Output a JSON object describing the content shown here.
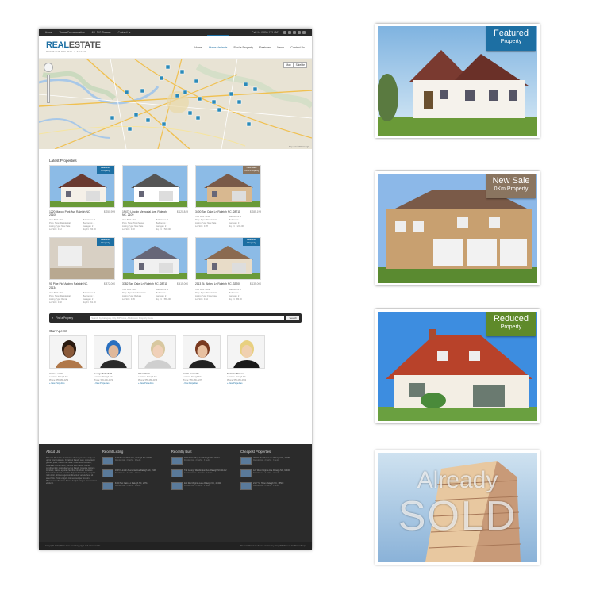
{
  "topbar": {
    "links": [
      "Home",
      "Theme Documentation",
      "ALL DIG Themes",
      "Contact Us"
    ],
    "phone": "Call Us: 0-800-123-4567"
  },
  "logo": {
    "part1": "REAL",
    "part2": "ESTATE",
    "tagline": "PREMIUM DRUPAL 7 THEME"
  },
  "nav": [
    "Home",
    "Home Variants",
    "Find a Property",
    "Features",
    "News",
    "Contact Us"
  ],
  "map": {
    "type_map": "Map",
    "type_sat": "Satellite",
    "attribution": "Map data ©2012 Google"
  },
  "latest": {
    "title": "Latest Properties",
    "cards": [
      {
        "addr": "1220 Macon Park Ave Raleigh NC, 21100",
        "price": "$ 250,999",
        "ribbon": "Featured",
        "ribbon_sub": "Property",
        "ribbon_color": "#1d6fa3",
        "specs": [
          "Year Built: 2012",
          "Bathrooms: 3",
          "Prop. Type: Residential",
          "Bedrooms: 4",
          "Listing Type: New Sale",
          "Garages: 2",
          "Lot Size: 0.12",
          "Sq. Ft: 450.00"
        ]
      },
      {
        "addr": "19472 Lincoln Memorial Ave, Raleigh NC, 2109",
        "price": "$ 120,849",
        "ribbon": "",
        "ribbon_sub": "",
        "ribbon_color": "",
        "specs": [
          "Year Built: 2011",
          "Bathrooms: 2",
          "Prop. Type: Townhouse",
          "Bedrooms: 3",
          "Listing Type: New Sale",
          "Garages: 2",
          "Lot Size: 0.22",
          "Sq. Ft: 2 560.00"
        ]
      },
      {
        "addr": "3400 Tan Oaks Ln Raleigh NC, 28711",
        "price": "$ 285,199",
        "ribbon": "New Sale",
        "ribbon_sub": "OKm Property",
        "ribbon_color": "#8a7560",
        "specs": [
          "Year Built: 2010",
          "Bathrooms: 3",
          "Prop. Type: Residential",
          "Bedrooms: 4",
          "Listing Type: New Sale",
          "Garages: 3",
          "Lot Size: 0.78",
          "Sq. Ft: 3 225.00"
        ]
      },
      {
        "addr": "91 Pine Ptof Audrey Raleigh NC, 21134",
        "price": "$ 872,000",
        "ribbon": "Featured",
        "ribbon_sub": "Property",
        "ribbon_color": "#1d6fa3",
        "specs": [
          "Year Built: 2012",
          "Bathrooms: 4",
          "Prop. Type: Residential",
          "Bedrooms: 5",
          "Listing Type: Rental",
          "Garages: 2",
          "Lot Size: 0.32",
          "Sq. Ft: 651.00"
        ]
      },
      {
        "addr": "3382 Tan Oaks Ln Raleigh NC, 28711",
        "price": "$ 415,000",
        "ribbon": "",
        "ribbon_sub": "",
        "ribbon_color": "",
        "specs": [
          "Year Built: 2009",
          "Bathrooms: 3",
          "Prop. Type: Condominium",
          "Bedrooms: 4",
          "Listing Type: Reduce",
          "Garages: 2",
          "Lot Size: 0.45",
          "Sq. Ft: 2 856.00"
        ]
      },
      {
        "addr": "2113 St. Abbey Ln Raleigh NC, 33200",
        "price": "$ 135,000",
        "ribbon": "Featured",
        "ribbon_sub": "Property",
        "ribbon_color": "#1d6fa3",
        "specs": [
          "Year Built: 2009",
          "Bathrooms: 2",
          "Prop. Type: Residential",
          "Bedrooms: 4",
          "Listing Type: Foreclosed",
          "Garages: 2",
          "Lot Size: 0.54",
          "Sq. Ft: 380.00"
        ]
      }
    ]
  },
  "search": {
    "label": "Find a Property",
    "placeholder": "Search by Category, City, ZIP Code, Address or Property Code",
    "button": "Search"
  },
  "agents": {
    "title": "Our Agents",
    "list": [
      {
        "name": "Annie Lowris",
        "location": "Location: Raleigh NC",
        "phone": "Phone: 555-286-4252",
        "link": "» View Properties",
        "shirt": "#b0784a",
        "skin": "#8a5a3a",
        "hair": "#2a1a10"
      },
      {
        "name": "George Schofield",
        "location": "Location: Raleigh NC",
        "phone": "Phone: 555-286-4372",
        "link": "» View Properties",
        "shirt": "#2a2a2a",
        "skin": "#e0b89a",
        "hair": "#2a70c0"
      },
      {
        "name": "Olivia Paris",
        "location": "Location: Raleigh NC",
        "phone": "Phone: 555-286-4153",
        "link": "» View Properties",
        "shirt": "#cfcfcf",
        "skin": "#f0d0b8",
        "hair": "#d8c8a0"
      },
      {
        "name": "Sarah Connolly",
        "location": "Location: Raleigh NC",
        "phone": "Phone: 555-286-4237",
        "link": "» View Properties",
        "shirt": "#222",
        "skin": "#e8c0a0",
        "hair": "#7a3a20"
      },
      {
        "name": "Stefanie Mason",
        "location": "Location: Raleigh NC",
        "phone": "Phone: 555-286-4352",
        "link": "» View Properties",
        "shirt": "#1a1a1a",
        "skin": "#f0d0b0",
        "hair": "#e8d080"
      }
    ]
  },
  "footer": {
    "about_title": "About Us",
    "about_text": "This is a Premium Real Estate theme you can easily set up for your business. Curabitur blandit sem, consectetur gravida justo, blandit nec ante. Cras lorem tincidunt, ornare ac lacinia risus, porttitor sed massa. Donec condimentum justo vitae lectus blandit molestie pretium tincidunt, massa egestas faucibus tincidunt. Vivamus fermentum viverra nec felis aliquam fermentum, aliquam nibh dolor, ultricies eget condimentum vel, eleifend sit amet felis. Proin ut ligula nisi sed semper pretium. Phasellus in dictumst. Donec feugiat congue et in ut amet eleifend.",
    "columns": [
      {
        "title": "Recent Listing",
        "items": [
          {
            "t": "1220 Macon Park Ave, Raleigh NC 21100",
            "s": "Residential · 3 baths · 4 beds"
          },
          {
            "t": "19472 Lincoln Memorial Ave Raleigh NC, 2109",
            "s": "Townhouse · 2 baths · 3 beds"
          },
          {
            "t": "3400 Tan Oaks Ln Raleigh NC, 28711",
            "s": "Residential · 3 baths · 4 beds"
          }
        ]
      },
      {
        "title": "Recently Built",
        "items": [
          {
            "t": "2020 Palm Alley Ave Raleigh NC, 12302",
            "s": "Residential · 2 baths · 3 beds"
          },
          {
            "t": "779 George Washington Ave, Raleigh NC 21432",
            "s": "Condominium · 3 baths · 4 beds"
          },
          {
            "t": "221 Red Virginia Lane Raleigh NC, 44321",
            "s": "Residential · 2 baths · 4 beds"
          }
        ]
      },
      {
        "title": "Cheapest Properties",
        "items": [
          {
            "t": "20002 Lilac Post Lane Raleigh NC, 44531",
            "s": "Residential · 2 baths · 3 beds"
          },
          {
            "t": "123 West Virginia Ave Raleigh NC, 34400",
            "s": "Townhouse · 2 baths · 3 beds"
          },
          {
            "t": "2137 St. Helen Raleigh NC, 15500",
            "s": "Residential · 2 baths · 4 beds"
          }
        ]
      }
    ],
    "copyright": "Copyright 2013, Place here your Copyright and Licensal Info.",
    "credit": "Drupal 7 Premium Theme created by DrupalDIYthemes for ThemeSnap"
  },
  "showcase": [
    {
      "ribbon": "Featured",
      "sub": "Property",
      "color": "#1d6fa3"
    },
    {
      "ribbon": "New Sale",
      "sub": "0Km Property",
      "color": "#8a7560"
    },
    {
      "ribbon": "Reduced",
      "sub": "Property",
      "color": "#5f8a2a"
    },
    {
      "line1": "Already",
      "line2": "SOLD"
    }
  ]
}
